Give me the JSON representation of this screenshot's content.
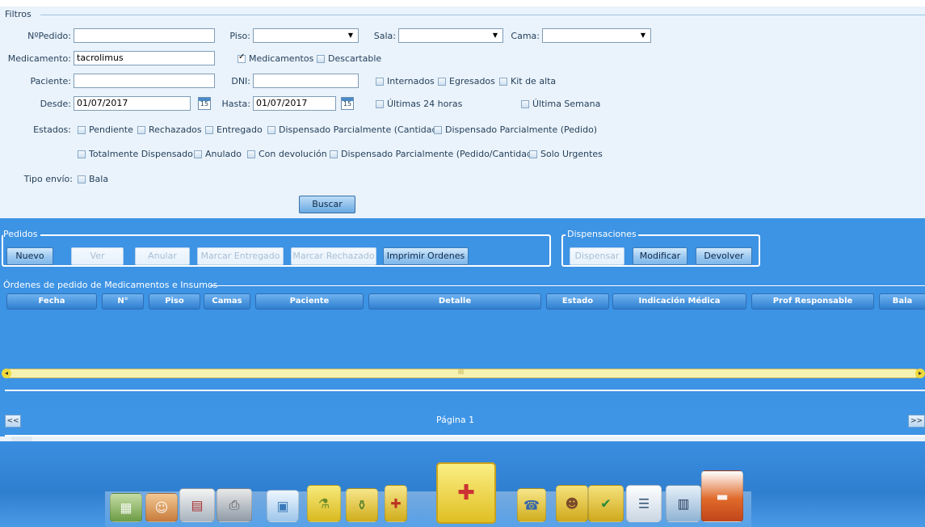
{
  "filtros": {
    "legend": "Filtros",
    "nro_pedido": {
      "label": "NºPedido:",
      "value": ""
    },
    "piso": {
      "label": "Piso:",
      "value": ""
    },
    "sala": {
      "label": "Sala:",
      "value": ""
    },
    "cama": {
      "label": "Cama:",
      "value": ""
    },
    "medicamento": {
      "label": "Medicamento:",
      "value": "tacrolimus"
    },
    "medicamentos_cb": {
      "label": "Medicamentos",
      "checked": true
    },
    "descartable_cb": {
      "label": "Descartable",
      "checked": false
    },
    "paciente": {
      "label": "Paciente:",
      "value": ""
    },
    "dni": {
      "label": "DNI:",
      "value": ""
    },
    "internados_cb": {
      "label": "Internados",
      "checked": false
    },
    "egresados_cb": {
      "label": "Egresados",
      "checked": false
    },
    "kit_alta_cb": {
      "label": "Kit de alta",
      "checked": false
    },
    "desde": {
      "label": "Desde:",
      "value": "01/07/2017"
    },
    "hasta": {
      "label": "Hasta:",
      "value": "01/07/2017"
    },
    "calendar_day": "15",
    "ultimas24_cb": {
      "label": "Últimas 24 horas",
      "checked": false
    },
    "ultima_semana_cb": {
      "label": "Última Semana",
      "checked": false
    },
    "estados_label": "Estados:",
    "estados": [
      "Pendiente",
      "Rechazados",
      "Entregado",
      "Dispensado Parcialmente (Cantidad)",
      "Dispensado Parcialmente (Pedido)",
      "Totalmente Dispensado",
      "Anulado",
      "Con devolución",
      "Dispensado Parcialmente (Pedido/Cantidad)",
      "Solo Urgentes"
    ],
    "tipo_envio_label": "Tipo envío:",
    "bala_cb": {
      "label": "Bala",
      "checked": false
    },
    "buscar_label": "Buscar"
  },
  "pedidos": {
    "legend": "Pedidos",
    "nuevo": "Nuevo",
    "ver": "Ver",
    "anular": "Anular",
    "marcar_entregado": "Marcar Entregado",
    "marcar_rechazado": "Marcar Rechazado",
    "imprimir_ordenes": "Imprimir Ordenes"
  },
  "dispensaciones": {
    "legend": "Dispensaciones",
    "dispensar": "Dispensar",
    "modificar": "Modificar",
    "devolver": "Devolver"
  },
  "ordenes": {
    "legend": "Órdenes de pedido de Medicamentos e Insumos",
    "columns": [
      "Fecha",
      "N°",
      "Piso",
      "Camas",
      "Paciente",
      "Detalle",
      "Estado",
      "Indicación Médica",
      "Prof Responsable",
      "Bala"
    ],
    "rows": []
  },
  "scroll": {
    "grip": "III",
    "left": "◂",
    "right": "▸"
  },
  "pager": {
    "prev": "<<",
    "next": ">>",
    "page_label": "Página 1"
  },
  "colors": {
    "accent": "#3d93e4",
    "header": "#2f7fd0",
    "scroll": "#f0d93a"
  },
  "dock_icons": [
    "beds-icon",
    "patients-icon",
    "documents-icon",
    "printer-icon",
    "id-card-icon",
    "medicine-bottle-icon",
    "lab-icon",
    "pharmacy-icon",
    "prescription-icon",
    "phone-icon",
    "doctor-icon",
    "checklist-icon",
    "report-icon",
    "monitor-icon",
    "patient-bed-icon"
  ]
}
